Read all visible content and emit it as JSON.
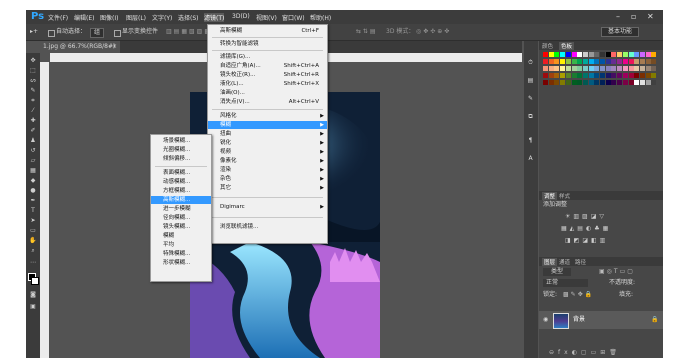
{
  "app": {
    "logo": "Ps"
  },
  "menubar": {
    "items": [
      "文件(F)",
      "编辑(E)",
      "图像(I)",
      "图层(L)",
      "文字(Y)",
      "选择(S)",
      "滤镜(T)",
      "3D(D)",
      "视图(V)",
      "窗口(W)",
      "帮助(H)"
    ],
    "active_index": 6,
    "window_controls": [
      "–",
      "▫",
      "✕"
    ]
  },
  "options": {
    "auto_select_label": "自动选择：",
    "auto_select_value": "组",
    "transform_label": "显示变换控件",
    "mode_label": "3D 模式：",
    "workspace": "基本功能"
  },
  "document": {
    "tab_title": "1.jpg @ 66.7%(RGB/8#)"
  },
  "filter_menu": {
    "items": [
      {
        "label": "高斯模糊",
        "shortcut": "Ctrl+F"
      },
      {
        "sep": true
      },
      {
        "label": "转换为智能滤镜"
      },
      {
        "sep": true
      },
      {
        "label": "滤镜库(G)..."
      },
      {
        "label": "自适应广角(A)...",
        "shortcut": "Shift+Ctrl+A"
      },
      {
        "label": "镜头校正(R)...",
        "shortcut": "Shift+Ctrl+R"
      },
      {
        "label": "液化(L)...",
        "shortcut": "Shift+Ctrl+X"
      },
      {
        "label": "油画(O)..."
      },
      {
        "label": "消失点(V)...",
        "shortcut": "Alt+Ctrl+V"
      },
      {
        "sep": true
      },
      {
        "label": "风格化",
        "sub": true
      },
      {
        "label": "模糊",
        "sub": true,
        "highlight": true
      },
      {
        "label": "扭曲",
        "sub": true
      },
      {
        "label": "锐化",
        "sub": true
      },
      {
        "label": "视频",
        "sub": true
      },
      {
        "label": "像素化",
        "sub": true
      },
      {
        "label": "渲染",
        "sub": true
      },
      {
        "label": "杂色",
        "sub": true
      },
      {
        "label": "其它",
        "sub": true
      },
      {
        "sep": true
      },
      {
        "label": "Digimarc",
        "sub": true
      },
      {
        "sep": true
      },
      {
        "label": "浏览联机滤镜..."
      }
    ]
  },
  "blur_submenu": {
    "items": [
      {
        "label": "场景模糊..."
      },
      {
        "label": "光圈模糊..."
      },
      {
        "label": "倾斜偏移..."
      },
      {
        "sep": true
      },
      {
        "label": "表面模糊..."
      },
      {
        "label": "动感模糊..."
      },
      {
        "label": "方框模糊..."
      },
      {
        "label": "高斯模糊...",
        "highlight": true
      },
      {
        "label": "进一步模糊"
      },
      {
        "label": "径向模糊..."
      },
      {
        "label": "镜头模糊..."
      },
      {
        "label": "模糊"
      },
      {
        "label": "平均"
      },
      {
        "label": "特殊模糊..."
      },
      {
        "label": "形状模糊..."
      }
    ]
  },
  "panels": {
    "swatch_tabs": [
      "颜色",
      "色板"
    ],
    "adjust_tabs": [
      "调整",
      "样式"
    ],
    "adjust_title": "添加调整",
    "layer_tabs": [
      "图层",
      "通道",
      "路径"
    ],
    "layer_kind": "类型",
    "blend_mode": "正常",
    "opacity_label": "不透明度:",
    "lock_label": "锁定:",
    "fill_label": "填充:",
    "layer_name": "背景"
  },
  "colors": {
    "swatch_rows": [
      [
        "#ff0000",
        "#ffff00",
        "#00ff00",
        "#00ffff",
        "#0000ff",
        "#ff00ff",
        "#ffffff",
        "#cccccc",
        "#999999",
        "#666666",
        "#333333",
        "#000000",
        "#ff6666",
        "#ffcc66",
        "#99ff66",
        "#66ffcc",
        "#6699ff",
        "#cc66ff",
        "#ff66cc",
        "#ffaa00"
      ],
      [
        "#ed1c24",
        "#f26522",
        "#f7941d",
        "#fff200",
        "#8dc63f",
        "#39b54a",
        "#00a651",
        "#00a99d",
        "#00aeef",
        "#0072bc",
        "#0054a6",
        "#2e3192",
        "#662d91",
        "#92278f",
        "#ec008c",
        "#ed145b",
        "#c69c6d",
        "#a67c52",
        "#8c6239",
        "#754c24"
      ],
      [
        "#f69679",
        "#f9ad81",
        "#fdc68a",
        "#fff799",
        "#c4df9b",
        "#a3d39c",
        "#82ca9c",
        "#7accc8",
        "#6dcff6",
        "#7da7d9",
        "#8393ca",
        "#8781bd",
        "#a186be",
        "#bd8cbf",
        "#f49ac1",
        "#f5989d",
        "#e6c8a8",
        "#c7b299",
        "#998675",
        "#736357"
      ],
      [
        "#9e0b0f",
        "#a0410d",
        "#a36209",
        "#aba000",
        "#598527",
        "#1a7b30",
        "#007236",
        "#00746b",
        "#0076a3",
        "#004a80",
        "#003471",
        "#1b1464",
        "#440e62",
        "#630460",
        "#9e005d",
        "#9e0039",
        "#790000",
        "#7b2e00",
        "#7d4900",
        "#827b00"
      ],
      [
        "#790000",
        "#7b2e00",
        "#7d4900",
        "#827b00",
        "#406618",
        "#005e20",
        "#005826",
        "#005952",
        "#005b7f",
        "#003663",
        "#002157",
        "#0d004c",
        "#32004b",
        "#4b0049",
        "#7b0046",
        "#7a0026",
        "#ffffff",
        "#e0e0e0",
        "#a0a0a0",
        "#404040"
      ]
    ]
  }
}
